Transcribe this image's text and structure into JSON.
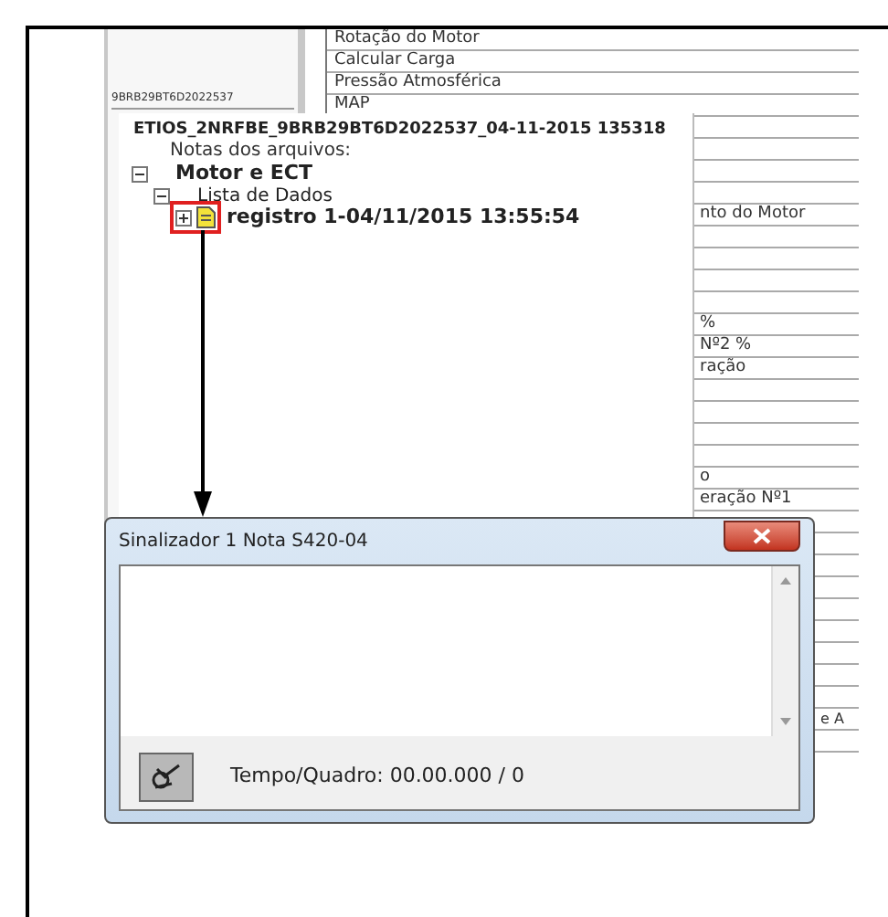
{
  "left_panel": {
    "vin": "9BRB29BT6D2022537"
  },
  "data_list": [
    {
      "kind": "full",
      "text": "Rotação do Motor"
    },
    {
      "kind": "full",
      "text": "Calcular Carga"
    },
    {
      "kind": "full",
      "text": "Pressão Atmosférica"
    },
    {
      "kind": "full",
      "text": "MAP"
    },
    {
      "kind": "empty"
    },
    {
      "kind": "empty"
    },
    {
      "kind": "empty"
    },
    {
      "kind": "empty"
    },
    {
      "kind": "partial",
      "text": "nto do Motor"
    },
    {
      "kind": "empty"
    },
    {
      "kind": "empty"
    },
    {
      "kind": "empty"
    },
    {
      "kind": "empty"
    },
    {
      "kind": "partial",
      "text": "%"
    },
    {
      "kind": "partial",
      "text": "Nº2 %"
    },
    {
      "kind": "partial",
      "text": "ração"
    },
    {
      "kind": "empty"
    },
    {
      "kind": "empty"
    },
    {
      "kind": "empty"
    },
    {
      "kind": "empty"
    },
    {
      "kind": "partial",
      "text": "o"
    },
    {
      "kind": "partial",
      "text": "eração Nº1"
    },
    {
      "kind": "empty"
    },
    {
      "kind": "empty"
    },
    {
      "kind": "empty"
    },
    {
      "kind": "empty"
    },
    {
      "kind": "empty"
    },
    {
      "kind": "empty"
    },
    {
      "kind": "empty"
    },
    {
      "kind": "empty"
    },
    {
      "kind": "empty"
    },
    {
      "kind": "edge",
      "text": "e A"
    },
    {
      "kind": "empty"
    }
  ],
  "file_tree": {
    "title": "ETIOS_2NRFBE_9BRB29BT6D2022537_04-11-2015 135318",
    "notes_label": "Notas dos arquivos:",
    "nodes": [
      {
        "label": "Motor e ECT",
        "bold": true,
        "expanded": true,
        "children": [
          {
            "label": "Lista de Dados",
            "bold": false,
            "expanded": true,
            "children": [
              {
                "label": "registro 1-04/11/2015 13:55:54",
                "bold": true,
                "expanded": false,
                "highlighted": true
              }
            ]
          }
        ]
      }
    ]
  },
  "dialog": {
    "title": "Sinalizador 1 Nota S420-04",
    "time_label": "Tempo/Quadro: 00.00.000 / 0"
  }
}
